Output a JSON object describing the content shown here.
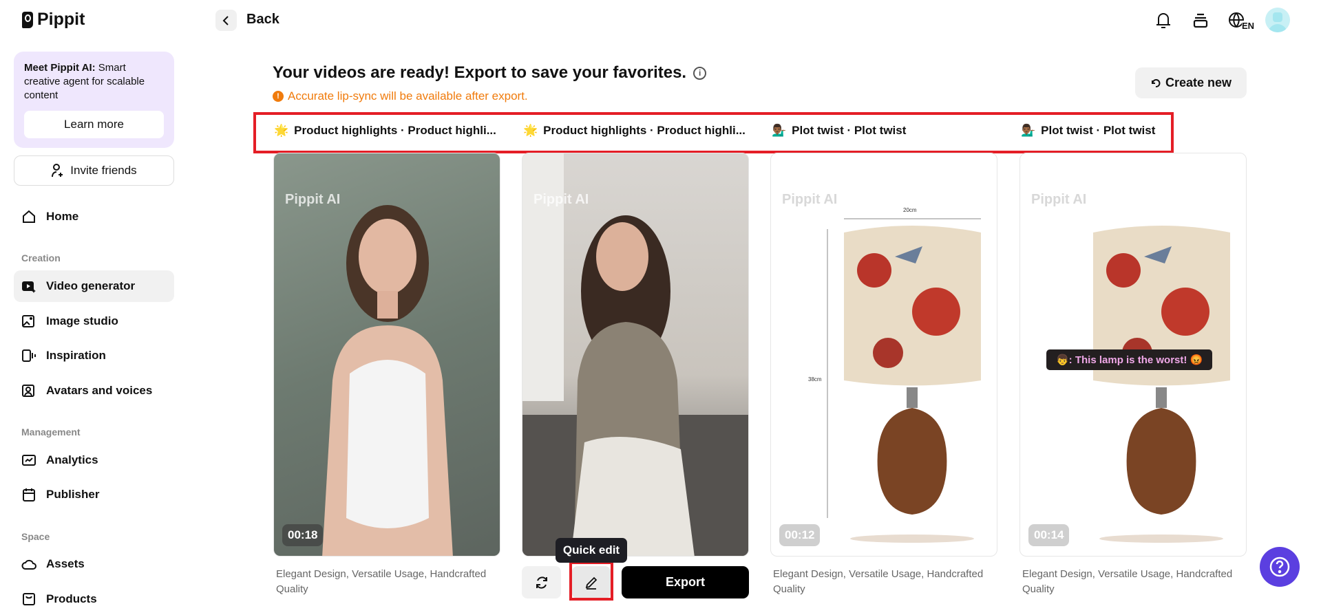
{
  "app": {
    "name": "Pippit"
  },
  "promo": {
    "title_bold": "Meet Pippit AI:",
    "title_rest": " Smart creative agent for scalable content",
    "button": "Learn more"
  },
  "invite": "Invite friends",
  "nav": {
    "home": "Home",
    "creation_label": "Creation",
    "video_generator": "Video generator",
    "image_studio": "Image studio",
    "inspiration": "Inspiration",
    "avatars": "Avatars and voices",
    "management_label": "Management",
    "analytics": "Analytics",
    "publisher": "Publisher",
    "space_label": "Space",
    "assets": "Assets",
    "products": "Products"
  },
  "header": {
    "back": "Back",
    "language": "EN"
  },
  "main": {
    "title": "Your videos are ready! Export to save your favorites.",
    "warning": "Accurate lip-sync will be available after export.",
    "create_new": "Create new",
    "tabs": [
      {
        "emoji": "🌟",
        "label": "Product highlights · Product highli..."
      },
      {
        "emoji": "🌟",
        "label": "Product highlights · Product highli..."
      },
      {
        "emoji": "💁🏾‍♂️",
        "label": "Plot twist · Plot twist"
      },
      {
        "emoji": "💁🏾‍♂️",
        "label": "Plot twist · Plot twist"
      }
    ],
    "cards": [
      {
        "duration": "00:18",
        "caption": "Elegant Design, Versatile Usage, Handcrafted Quality",
        "watermark": "Pippit AI"
      },
      {
        "duration": "",
        "caption": "",
        "watermark": "Pippit AI"
      },
      {
        "duration": "00:12",
        "caption": "Elegant Design, Versatile Usage, Handcrafted Quality",
        "watermark": "Pippit AI",
        "dim_width": "20cm",
        "dim_height": "38cm"
      },
      {
        "duration": "00:14",
        "caption": "Elegant Design, Versatile Usage, Handcrafted Quality",
        "watermark": "Pippit AI",
        "subtitle": "👦: This lamp is the worst! 😡"
      }
    ],
    "tooltip": "Quick edit",
    "export": "Export"
  },
  "colors": {
    "accent": "#5b3fe0",
    "warning": "#f07b0c",
    "highlight": "#e41e26"
  }
}
